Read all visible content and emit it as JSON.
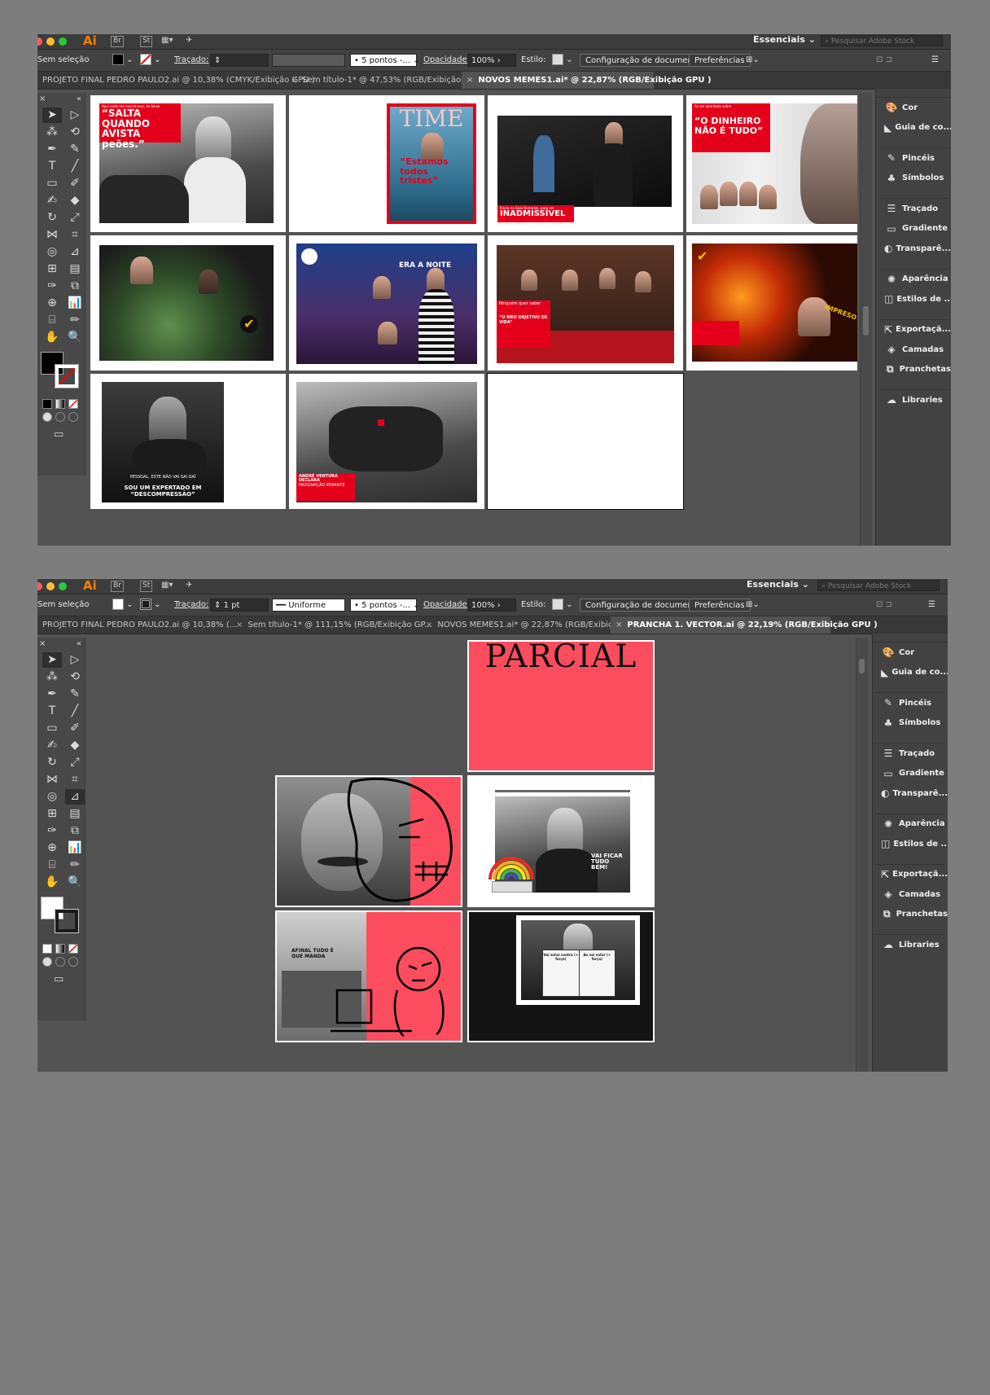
{
  "app": {
    "logo": "Ai",
    "workspace": "Essenciais",
    "stock_search_placeholder": "Pesquisar Adobe Stock"
  },
  "window1": {
    "control_bar": {
      "selection": "Sem seleção",
      "stroke_label": "Traçado:",
      "stroke_value": "",
      "brush": "5 pontos -...",
      "opacity_label": "Opacidade:",
      "opacity_value": "100%",
      "style_label": "Estilo:",
      "doc_setup": "Configuração de documento",
      "prefs": "Preferências"
    },
    "tabs": [
      {
        "label": "PROJETO FINAL PEDRO PAULO2.ai @ 10,38% (CMYK/Exibição GPU )",
        "active": false
      },
      {
        "label": "Sem título-1* @ 47,53% (RGB/Exibição GPU )",
        "active": false
      },
      {
        "label": "NOVOS MEMES1.ai* @ 22,87% (RGB/Exibição GPU )",
        "active": true
      }
    ],
    "artboards": [
      {
        "caption": "“SALTA QUANDO AVISTA peões.”",
        "small": "Aqui onde me encontrava, de baixo"
      },
      {
        "caption": "“Estamos todos tristes”",
        "small": "TIME"
      },
      {
        "caption": "INADMISSÍVEL",
        "small": "Rinda na Gala Nortadas, para ser"
      },
      {
        "caption": "“O DINHEIRO NÃO É TUDO”",
        "small": "Ao ser abordado sobre"
      },
      {
        "caption": "",
        "small": ""
      },
      {
        "caption": "",
        "small": "ERA A NOITE"
      },
      {
        "caption": "“O MEU OBJETIVO DE VIDA”",
        "small": "Ninguém quer saber"
      },
      {
        "caption": "",
        "small": "IMPRESO"
      },
      {
        "caption": "SOU UM EXPERTADO EM “DESCOMPRESSÃO”",
        "small": "PESSOAL, ESTE NÃO VAI SAI DAÍ"
      },
      {
        "caption": "ANDRÉ VENTURA DECLARA",
        "small": "INDIGNAÇÃO PERANTE"
      },
      {
        "caption": "",
        "small": ""
      }
    ]
  },
  "window2": {
    "control_bar": {
      "selection": "Sem seleção",
      "stroke_label": "Traçado:",
      "stroke_value": "1 pt",
      "stroke_profile": "Uniforme",
      "brush": "5 pontos -...",
      "opacity_label": "Opacidade:",
      "opacity_value": "100%",
      "style_label": "Estilo:",
      "doc_setup": "Configuração de documento",
      "prefs": "Preferências"
    },
    "tabs": [
      {
        "label": "PROJETO FINAL PEDRO PAULO2.ai @ 10,38% (...",
        "active": false
      },
      {
        "label": "Sem título-1* @ 111,15% (RGB/Exibição GP...",
        "active": false
      },
      {
        "label": "NOVOS MEMES1.ai* @ 22,87% (RGB/Exibição G...",
        "active": false
      },
      {
        "label": "PRANCHA 1. VECTOR.ai @ 22,19% (RGB/Exibição GPU )",
        "active": true
      }
    ],
    "artboards": {
      "title": "PARCIAL",
      "rainbow_caption": "VAI FICAR TUDO BEM!",
      "mural_caption": "AFINAL TUDO É QUE MANDA",
      "sign_left": "Vai votar contra (+ força)",
      "sign_right": "Ao vai votar (+ força)"
    }
  },
  "panels": [
    "Cor",
    "Guia de co...",
    "Pincéis",
    "Símbolos",
    "Traçado",
    "Gradiente",
    "Transparê...",
    "Aparência",
    "Estilos de ...",
    "Exportaçã...",
    "Camadas",
    "Pranchetas",
    "Libraries"
  ],
  "colors": {
    "accent_red": "#e4001b",
    "salmon": "#fb4d5d",
    "ui_dark": "#535353"
  }
}
